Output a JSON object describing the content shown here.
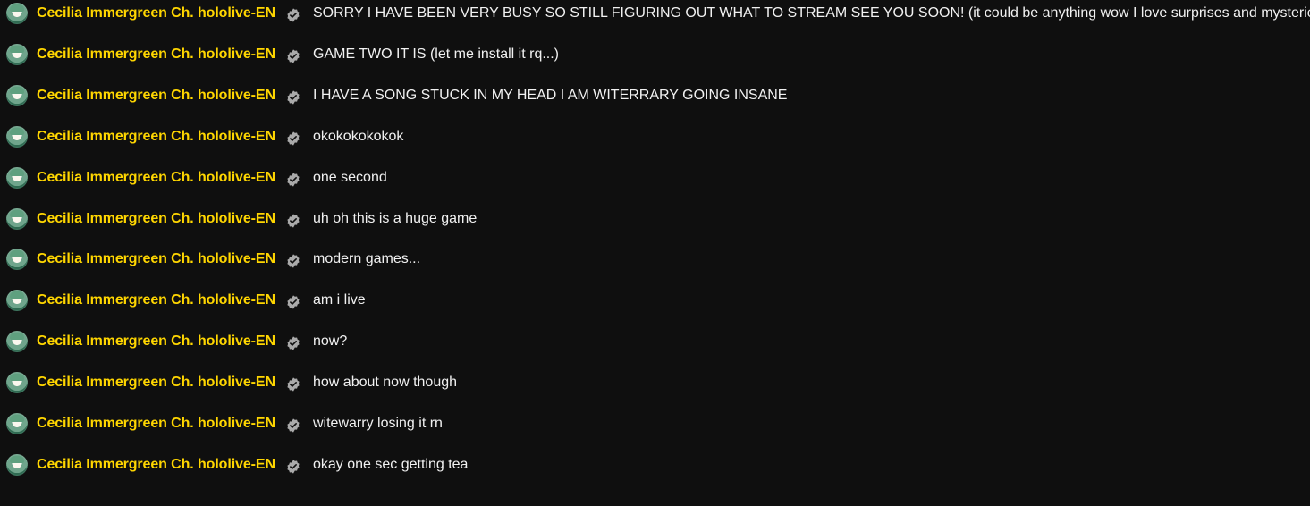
{
  "chat": {
    "author_name": "Cecilia Immergreen Ch. hololive-EN",
    "author_color": "#ffd600",
    "badge_icon": "verified-check-icon",
    "messages": [
      "SORRY I HAVE BEEN VERY BUSY SO STILL FIGURING OUT WHAT TO STREAM SEE YOU SOON! (it could be anything wow I love surprises and mysteries)",
      "GAME TWO IT IS (let me install it rq...)",
      "I HAVE A SONG STUCK IN MY HEAD I AM WITERRARY GOING INSANE",
      "okokokokokok",
      "one second",
      "uh oh this is a huge game",
      "modern games...",
      "am i live",
      "now?",
      "how about now though",
      "witewarry losing it rn",
      "okay one sec getting tea"
    ]
  }
}
